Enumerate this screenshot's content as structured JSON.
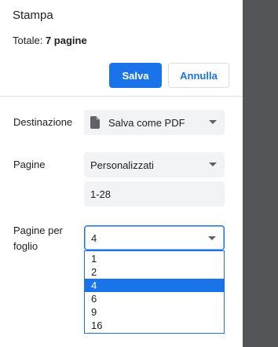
{
  "dialog": {
    "title": "Stampa",
    "total_label": "Totale:",
    "total_value": "7 pagine",
    "save_label": "Salva",
    "cancel_label": "Annulla"
  },
  "settings": {
    "destination": {
      "label": "Destinazione",
      "value": "Salva come PDF",
      "icon": "document-icon"
    },
    "pages": {
      "label": "Pagine",
      "value": "Personalizzati",
      "range_value": "1-28"
    },
    "pages_per_sheet": {
      "label_line1": "Pagine per",
      "label_line2": "foglio",
      "value": "4",
      "options": [
        "1",
        "2",
        "4",
        "6",
        "9",
        "16"
      ],
      "selected_index": 2
    }
  },
  "colors": {
    "accent": "#1a73e8",
    "preview_background": "#525659",
    "field_background": "#f1f3f4"
  }
}
